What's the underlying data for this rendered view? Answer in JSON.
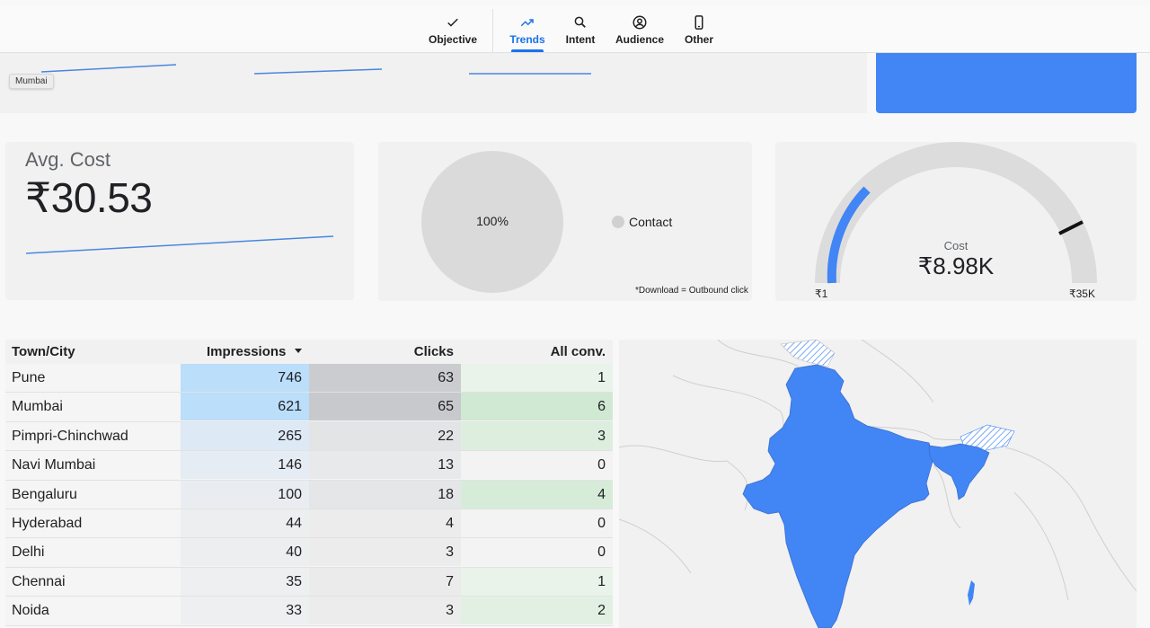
{
  "nav": {
    "items": [
      {
        "label": "Objective",
        "icon": "check-icon"
      },
      {
        "label": "Trends",
        "icon": "trending-up-icon",
        "active": true
      },
      {
        "label": "Intent",
        "icon": "search-icon"
      },
      {
        "label": "Audience",
        "icon": "account-circle-icon"
      },
      {
        "label": "Other",
        "icon": "phone-icon"
      }
    ]
  },
  "strip": {
    "tooltip": "Mumbai"
  },
  "avg_cost": {
    "label": "Avg. Cost",
    "value": "₹30.53"
  },
  "pie": {
    "percent": "100%",
    "legend": "Contact",
    "footnote": "*Download = Outbound click"
  },
  "gauge": {
    "label": "Cost",
    "value": "₹8.98K",
    "min": "₹1",
    "max": "₹35K"
  },
  "table": {
    "headers": {
      "city": "Town/City",
      "impressions": "Impressions",
      "clicks": "Clicks",
      "conv": "All conv."
    },
    "rows": [
      {
        "city": "Pune",
        "impressions": "746",
        "clicks": "63",
        "conv": "1"
      },
      {
        "city": "Mumbai",
        "impressions": "621",
        "clicks": "65",
        "conv": "6"
      },
      {
        "city": "Pimpri-Chinchwad",
        "impressions": "265",
        "clicks": "22",
        "conv": "3"
      },
      {
        "city": "Navi Mumbai",
        "impressions": "146",
        "clicks": "13",
        "conv": "0"
      },
      {
        "city": "Bengaluru",
        "impressions": "100",
        "clicks": "18",
        "conv": "4"
      },
      {
        "city": "Hyderabad",
        "impressions": "44",
        "clicks": "4",
        "conv": "0"
      },
      {
        "city": "Delhi",
        "impressions": "40",
        "clicks": "3",
        "conv": "0"
      },
      {
        "city": "Chennai",
        "impressions": "35",
        "clicks": "7",
        "conv": "1"
      },
      {
        "city": "Noida",
        "impressions": "33",
        "clicks": "3",
        "conv": "2"
      }
    ]
  },
  "colors": {
    "accent": "#1a73e8",
    "map_fill": "#4285f4",
    "impressions_heat": [
      "#bbdefb",
      "#bbdefb",
      "#dde9f5",
      "#e6ecf3",
      "#e9edf2",
      "#eceef0",
      "#eceef0",
      "#edeff1",
      "#edeff1"
    ],
    "clicks_heat": [
      "#cbcccf",
      "#c8c9cc",
      "#e3e4e6",
      "#e8e9ea",
      "#e5e6e8",
      "#ececec",
      "#ececec",
      "#ebebeb",
      "#ececec"
    ],
    "conv_heat": [
      "#e9f3ea",
      "#cfe9d3",
      "#ddeedf",
      "#f3f3f3",
      "#d6ecd9",
      "#f3f3f3",
      "#f3f3f3",
      "#e9f3ea",
      "#e2f0e4"
    ]
  }
}
